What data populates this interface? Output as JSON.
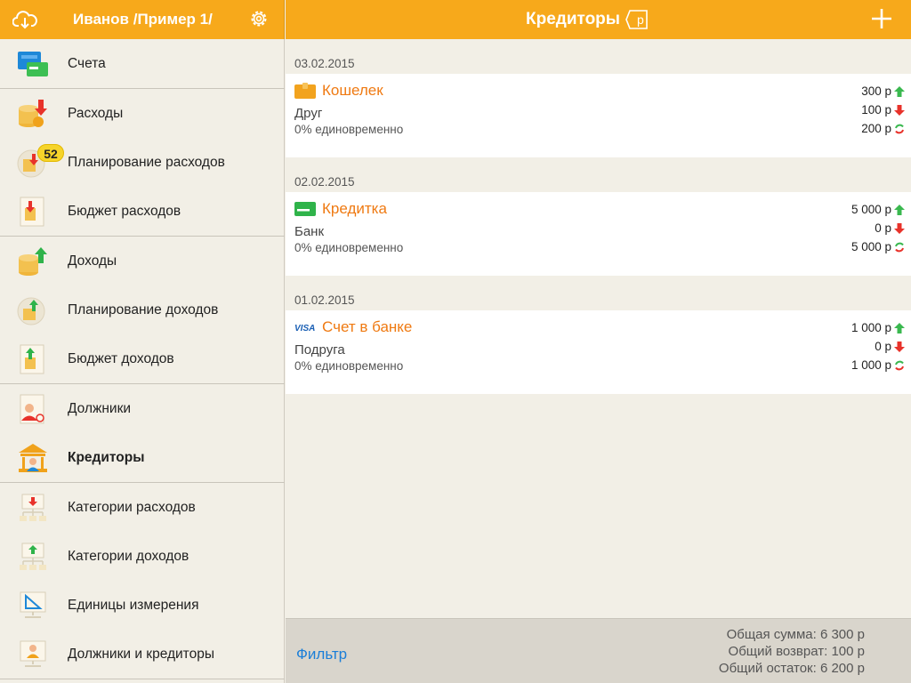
{
  "header_left": {
    "title": "Иванов /Пример 1/"
  },
  "header_right": {
    "title": "Кредиторы",
    "currency_symbol": "р"
  },
  "sidebar": {
    "items": [
      {
        "label": "Счета"
      },
      {
        "label": "Расходы"
      },
      {
        "label": "Планирование расходов",
        "badge": "52"
      },
      {
        "label": "Бюджет расходов"
      },
      {
        "label": "Доходы"
      },
      {
        "label": "Планирование доходов"
      },
      {
        "label": "Бюджет доходов"
      },
      {
        "label": "Должники"
      },
      {
        "label": "Кредиторы",
        "active": true
      },
      {
        "label": "Категории расходов"
      },
      {
        "label": "Категории доходов"
      },
      {
        "label": "Единицы измерения"
      },
      {
        "label": "Должники и кредиторы"
      }
    ]
  },
  "entries": [
    {
      "date": "03.02.2015",
      "name": "Кошелек",
      "counterparty": "Друг",
      "terms": "0% единовременно",
      "total": "300 р",
      "returned": "100 р",
      "remaining": "200 р",
      "icon": "wallet-icon"
    },
    {
      "date": "02.02.2015",
      "name": "Кредитка",
      "counterparty": "Банк",
      "terms": "0% единовременно",
      "total": "5 000 р",
      "returned": "0 р",
      "remaining": "5 000 р",
      "icon": "credit-card-icon"
    },
    {
      "date": "01.02.2015",
      "name": "Счет в банке",
      "counterparty": "Подруга",
      "terms": "0% единовременно",
      "total": "1 000 р",
      "returned": "0 р",
      "remaining": "1 000 р",
      "icon": "visa-icon",
      "icon_text": "VISA"
    }
  ],
  "footer": {
    "filter_label": "Фильтр",
    "total_sum": "Общая сумма: 6 300 р",
    "total_returned": "Общий возврат: 100 р",
    "total_remaining": "Общий остаток: 6 200 р"
  },
  "colors": {
    "accent": "#f7a91b",
    "link": "#1a7ed8",
    "entry_name": "#ef7a12"
  }
}
